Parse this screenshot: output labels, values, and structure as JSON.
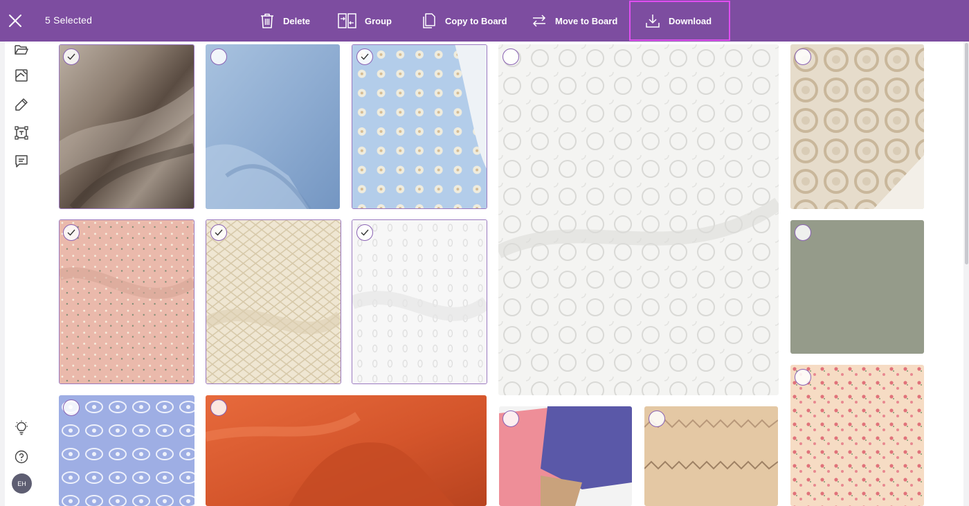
{
  "toolbar": {
    "selected_count_label": "5 Selected",
    "delete_label": "Delete",
    "group_label": "Group",
    "copy_label": "Copy to Board",
    "move_label": "Move to Board",
    "download_label": "Download",
    "background_color": "#7d4da0",
    "highlight_color": "#e04ef0"
  },
  "sidebar": {
    "icons": [
      "folder-icon",
      "board-icon",
      "pencil-icon",
      "text-frame-icon",
      "comment-icon",
      "lightbulb-icon",
      "help-icon"
    ],
    "avatar_initials": "EH"
  },
  "tiles": [
    {
      "name": "brown-satin",
      "selected": true
    },
    {
      "name": "blue-fleece",
      "selected": false
    },
    {
      "name": "blue-eyelet",
      "selected": true
    },
    {
      "name": "white-lace",
      "selected": false
    },
    {
      "name": "beige-crochet",
      "selected": false
    },
    {
      "name": "pink-floral",
      "selected": true
    },
    {
      "name": "cream-knit",
      "selected": true
    },
    {
      "name": "white-eyelet",
      "selected": true
    },
    {
      "name": "sage-green",
      "selected": false
    },
    {
      "name": "blue-embroidered",
      "selected": false
    },
    {
      "name": "orange-twill",
      "selected": false
    },
    {
      "name": "pink-purple-patchwork",
      "selected": false
    },
    {
      "name": "tan-knit",
      "selected": false
    },
    {
      "name": "peach-floral",
      "selected": false
    }
  ]
}
